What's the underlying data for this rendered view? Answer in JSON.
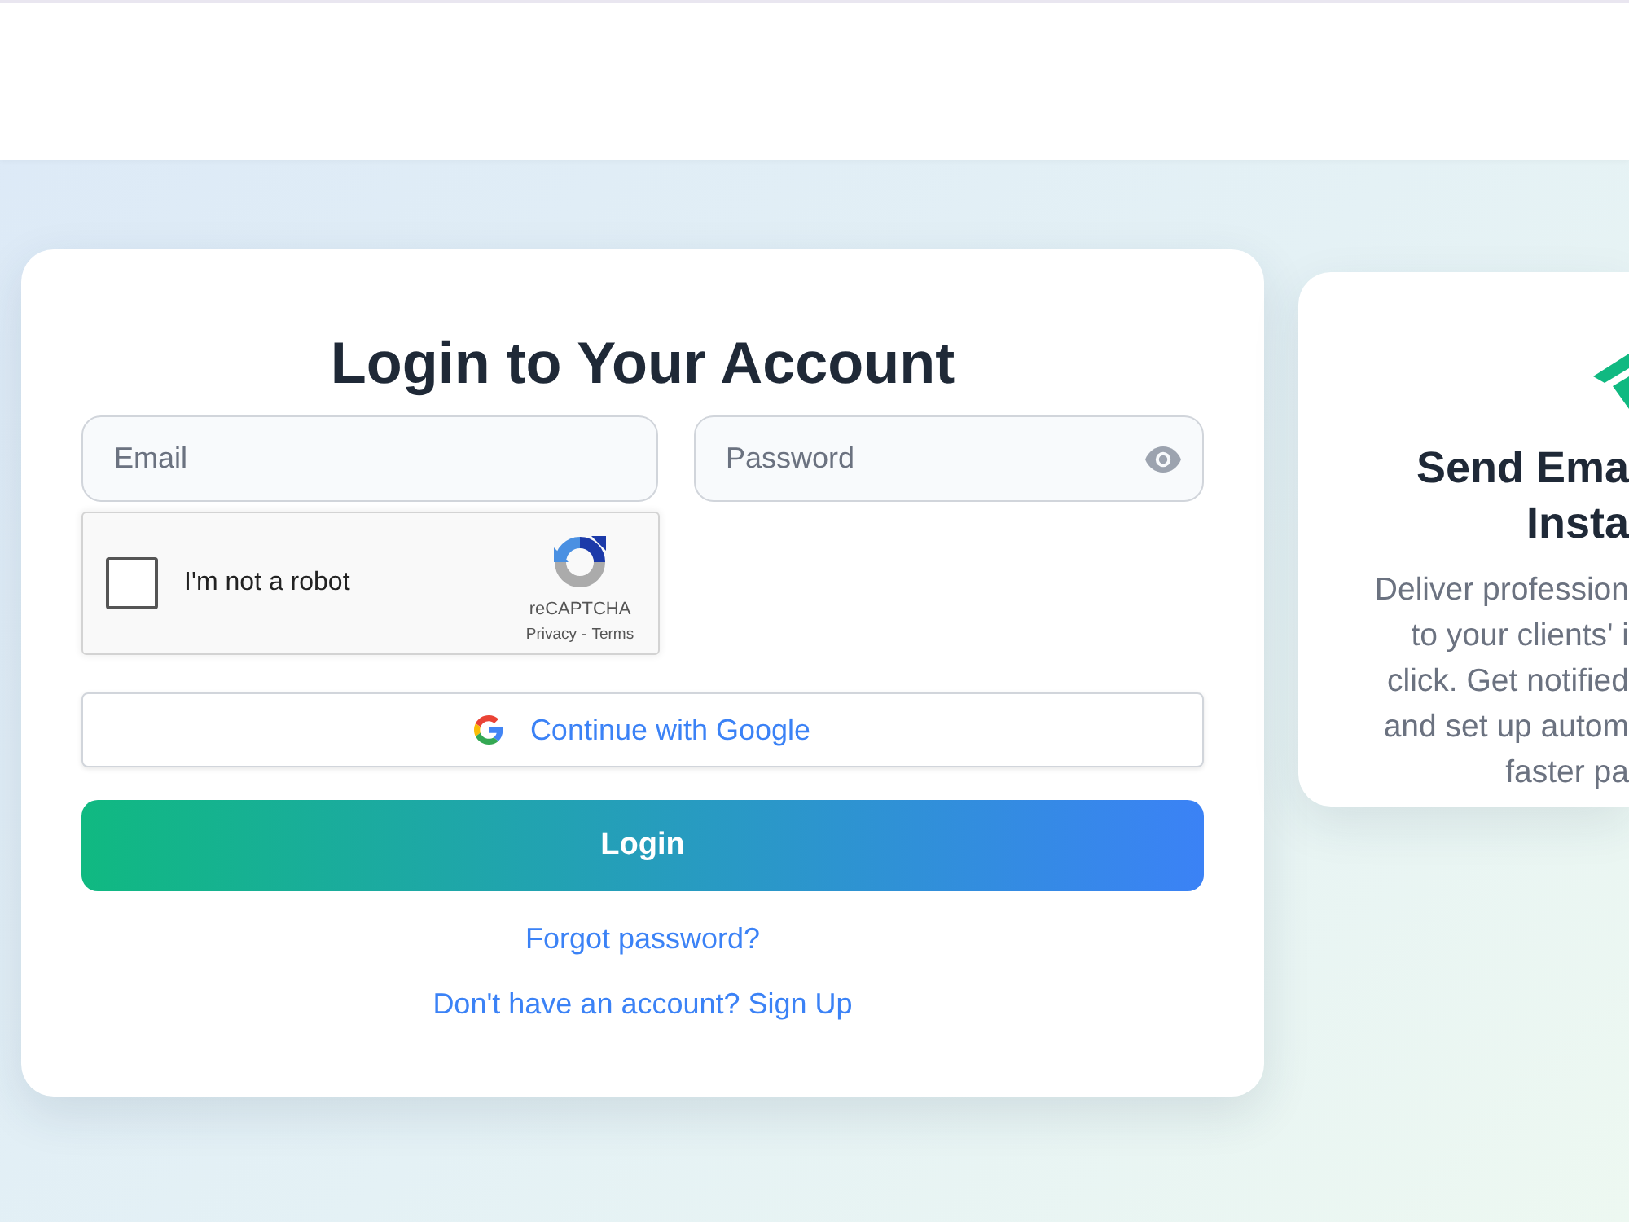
{
  "login_card": {
    "title": "Login to Your Account",
    "email_field": {
      "placeholder": "Email"
    },
    "password_field": {
      "placeholder": "Password"
    },
    "captcha": {
      "label": "I'm not a robot",
      "checked": false,
      "brand": "reCAPTCHA",
      "privacy_link": "Privacy",
      "separator": "-",
      "terms_link": "Terms"
    },
    "google_button": {
      "label": "Continue with Google"
    },
    "login_button": {
      "label": "Login"
    },
    "links": [
      "Forgot password?",
      "Don't have an account? Sign Up"
    ]
  },
  "feature_card": {
    "heading_lines": [
      "Send Ema",
      "Insta"
    ],
    "text_lines": [
      "Deliver profession",
      "to your clients' i",
      "click. Get notified",
      "and set up autom",
      "faster pa"
    ]
  }
}
